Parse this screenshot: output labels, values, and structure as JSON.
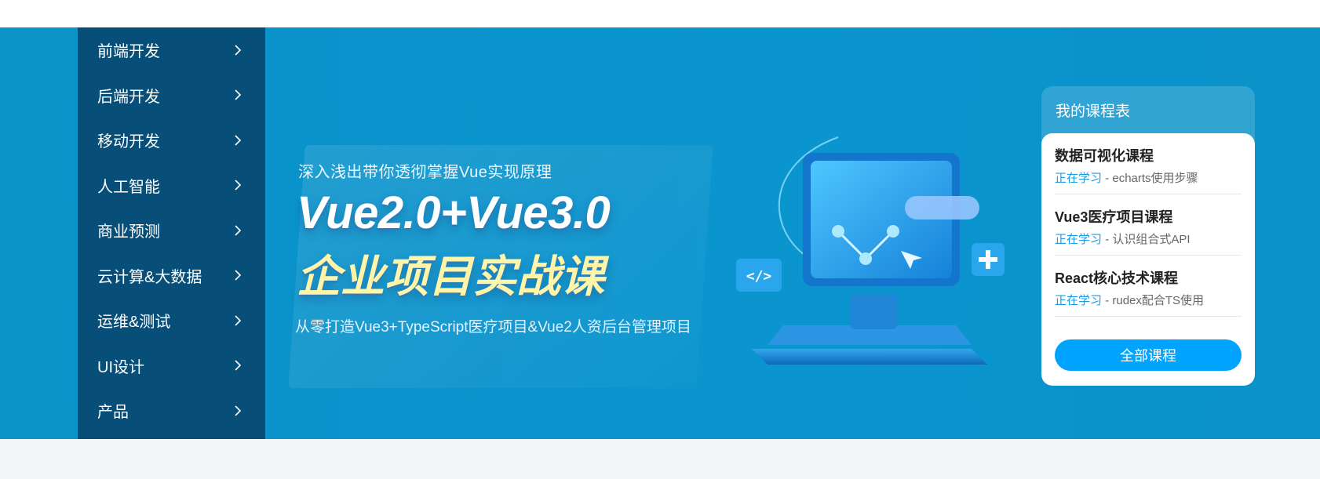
{
  "sidebar": {
    "items": [
      {
        "label": "前端开发",
        "icon": "chevron-right-icon"
      },
      {
        "label": "后端开发",
        "icon": "chevron-right-icon"
      },
      {
        "label": "移动开发",
        "icon": "chevron-right-icon"
      },
      {
        "label": "人工智能",
        "icon": "chevron-right-icon"
      },
      {
        "label": "商业预测",
        "icon": "chevron-right-icon"
      },
      {
        "label": "云计算&大数据",
        "icon": "chevron-right-icon"
      },
      {
        "label": "运维&测试",
        "icon": "chevron-right-icon"
      },
      {
        "label": "UI设计",
        "icon": "chevron-right-icon"
      },
      {
        "label": "产品",
        "icon": "chevron-right-icon"
      }
    ]
  },
  "banner": {
    "subtitle": "深入浅出带你透彻掌握Vue实现原理",
    "title_line1": "Vue2.0+Vue3.0",
    "title_line2": "企业项目实战课",
    "description": "从零打造Vue3+TypeScript医疗项目&Vue2人资后台管理项目"
  },
  "course_card": {
    "title": "我的课程表",
    "courses": [
      {
        "name": "数据可视化课程",
        "status": "正在学习",
        "separator": "-",
        "lesson": "echarts使用步骤"
      },
      {
        "name": "Vue3医疗项目课程",
        "status": "正在学习",
        "separator": "-",
        "lesson": "认识组合式API"
      },
      {
        "name": "React核心技术课程",
        "status": "正在学习",
        "separator": "-",
        "lesson": "rudex配合TS使用"
      }
    ],
    "all_button": "全部课程"
  },
  "colors": {
    "banner_bg": "#0a94c8",
    "sidebar_bg": "#0b4a72",
    "accent": "#00a4ff",
    "status_text": "#1a9be6",
    "title_highlight": "#fff4a8"
  }
}
